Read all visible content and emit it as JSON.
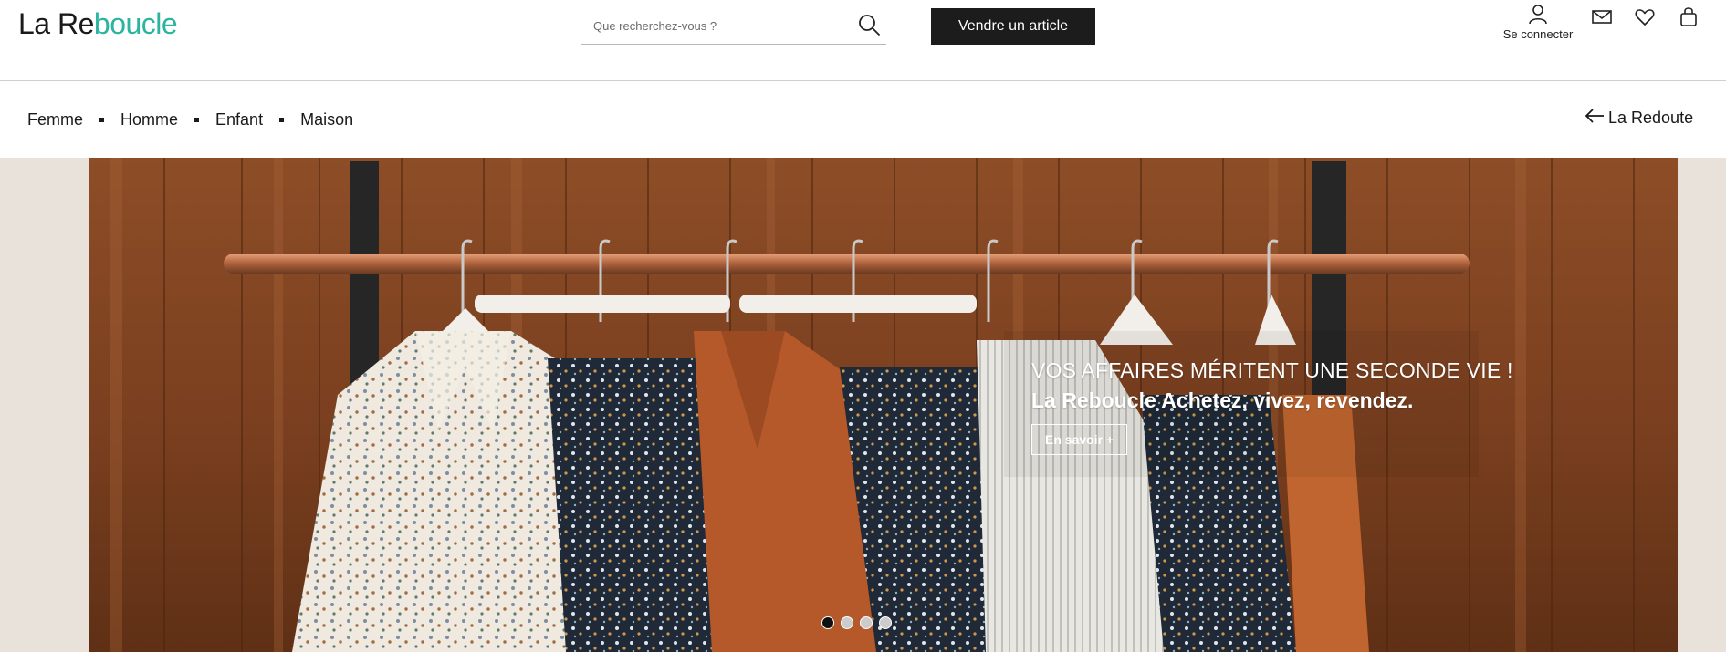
{
  "header": {
    "logo_part1": "La Re",
    "logo_part2": "boucle",
    "search": {
      "placeholder": "Que recherchez-vous ?",
      "value": ""
    },
    "sell_label": "Vendre un article",
    "account_label": "Se connecter",
    "icons": [
      "user-icon",
      "mail-icon",
      "heart-icon",
      "bag-icon",
      "search-icon"
    ]
  },
  "nav": {
    "categories": [
      "Femme",
      "Homme",
      "Enfant",
      "Maison"
    ],
    "back_label": "La Redoute"
  },
  "hero": {
    "title": "VOS AFFAIRES MÉRITENT UNE SECONDE VIE !",
    "subtitle": "La Reboucle Achetez, vivez, revendez.",
    "cta": "En savoir +",
    "slide_count": 4,
    "active_slide": 1
  },
  "colors": {
    "brand_accent": "#2bb5a0",
    "button_dark": "#1c1c1c",
    "wood": "#8a4a24",
    "copper_rail": "#b4663e"
  }
}
